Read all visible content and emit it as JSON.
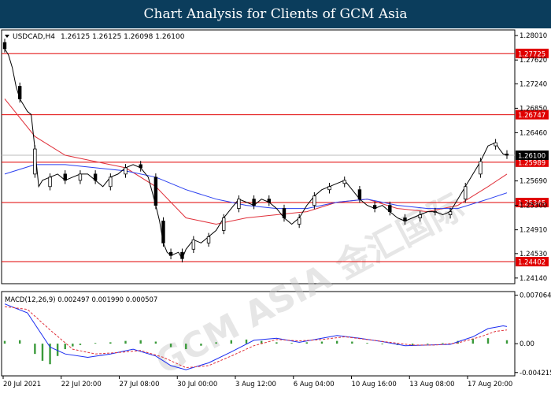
{
  "header": {
    "title": "Chart Analysis for Clients of GCM Asia"
  },
  "chart_data": {
    "type": "candlestick",
    "instrument": "USDCAD,H4",
    "ohlc_text": "1.26125 1.26125 1.26098 1.26100",
    "ylim": [
      1.2405,
      1.281
    ],
    "price_ticks": [
      "1.28010",
      "1.27620",
      "1.27240",
      "1.26850",
      "1.26460",
      "1.26100",
      "1.25690",
      "1.25300",
      "1.24910",
      "1.24530",
      "1.24140"
    ],
    "current_price": "1.26100",
    "levels": [
      {
        "label": "1.27725",
        "value": 1.27725
      },
      {
        "label": "1.26747",
        "value": 1.26747
      },
      {
        "label": "1.25989",
        "value": 1.25989
      },
      {
        "label": "1.25345",
        "value": 1.25345
      },
      {
        "label": "1.24402",
        "value": 1.24402
      }
    ],
    "x_labels": [
      "20 Jul 2021",
      "22 Jul 20:00",
      "27 Jul 08:00",
      "30 Jul 00:00",
      "3 Aug 12:00",
      "6 Aug 04:00",
      "10 Aug 16:00",
      "13 Aug 08:00",
      "17 Aug 20:00"
    ],
    "close_path": [
      [
        0,
        1.278
      ],
      [
        1,
        1.277
      ],
      [
        2,
        1.275
      ],
      [
        3,
        1.272
      ],
      [
        4,
        1.27
      ],
      [
        5,
        1.269
      ],
      [
        6,
        1.268
      ],
      [
        7,
        1.2675
      ],
      [
        8,
        1.262
      ],
      [
        9,
        1.256
      ],
      [
        10,
        1.257
      ],
      [
        12,
        1.2575
      ],
      [
        14,
        1.258
      ],
      [
        16,
        1.257
      ],
      [
        18,
        1.2575
      ],
      [
        20,
        1.258
      ],
      [
        22,
        1.258
      ],
      [
        24,
        1.257
      ],
      [
        26,
        1.256
      ],
      [
        28,
        1.2575
      ],
      [
        30,
        1.258
      ],
      [
        32,
        1.259
      ],
      [
        34,
        1.2595
      ],
      [
        36,
        1.259
      ],
      [
        38,
        1.2575
      ],
      [
        40,
        1.253
      ],
      [
        41,
        1.2505
      ],
      [
        42,
        1.247
      ],
      [
        43,
        1.2455
      ],
      [
        44,
        1.245
      ],
      [
        46,
        1.2455
      ],
      [
        47,
        1.2445
      ],
      [
        48,
        1.246
      ],
      [
        50,
        1.2475
      ],
      [
        52,
        1.247
      ],
      [
        54,
        1.248
      ],
      [
        56,
        1.249
      ],
      [
        58,
        1.251
      ],
      [
        60,
        1.2525
      ],
      [
        62,
        1.254
      ],
      [
        64,
        1.2535
      ],
      [
        66,
        1.253
      ],
      [
        68,
        1.254
      ],
      [
        70,
        1.2535
      ],
      [
        72,
        1.2525
      ],
      [
        74,
        1.251
      ],
      [
        76,
        1.25
      ],
      [
        78,
        1.251
      ],
      [
        80,
        1.253
      ],
      [
        82,
        1.2545
      ],
      [
        84,
        1.2555
      ],
      [
        86,
        1.256
      ],
      [
        88,
        1.2565
      ],
      [
        90,
        1.257
      ],
      [
        92,
        1.2555
      ],
      [
        94,
        1.254
      ],
      [
        96,
        1.253
      ],
      [
        98,
        1.2525
      ],
      [
        100,
        1.253
      ],
      [
        102,
        1.252
      ],
      [
        104,
        1.251
      ],
      [
        106,
        1.2505
      ],
      [
        108,
        1.251
      ],
      [
        110,
        1.2515
      ],
      [
        112,
        1.252
      ],
      [
        114,
        1.252
      ],
      [
        116,
        1.2515
      ],
      [
        118,
        1.252
      ],
      [
        120,
        1.254
      ],
      [
        122,
        1.256
      ],
      [
        124,
        1.258
      ],
      [
        126,
        1.26
      ],
      [
        128,
        1.2625
      ],
      [
        130,
        1.263
      ],
      [
        131,
        1.262
      ],
      [
        132,
        1.2612
      ],
      [
        133,
        1.261
      ]
    ],
    "candle_marks": [
      [
        0,
        1.279,
        1.278
      ],
      [
        4,
        1.272,
        1.27
      ],
      [
        8,
        1.258,
        1.262
      ],
      [
        12,
        1.256,
        1.2575
      ],
      [
        16,
        1.258,
        1.257
      ],
      [
        20,
        1.257,
        1.258
      ],
      [
        24,
        1.258,
        1.257
      ],
      [
        28,
        1.256,
        1.2575
      ],
      [
        32,
        1.258,
        1.259
      ],
      [
        36,
        1.2595,
        1.259
      ],
      [
        40,
        1.2575,
        1.253
      ],
      [
        42,
        1.2505,
        1.247
      ],
      [
        44,
        1.2455,
        1.245
      ],
      [
        47,
        1.2455,
        1.2445
      ],
      [
        50,
        1.246,
        1.2475
      ],
      [
        54,
        1.247,
        1.248
      ],
      [
        58,
        1.249,
        1.251
      ],
      [
        62,
        1.2525,
        1.254
      ],
      [
        66,
        1.254,
        1.253
      ],
      [
        70,
        1.254,
        1.2535
      ],
      [
        74,
        1.2525,
        1.251
      ],
      [
        78,
        1.25,
        1.251
      ],
      [
        82,
        1.253,
        1.2545
      ],
      [
        86,
        1.2555,
        1.256
      ],
      [
        90,
        1.2565,
        1.257
      ],
      [
        94,
        1.2555,
        1.254
      ],
      [
        98,
        1.253,
        1.2525
      ],
      [
        102,
        1.253,
        1.252
      ],
      [
        106,
        1.251,
        1.2505
      ],
      [
        110,
        1.251,
        1.2515
      ],
      [
        114,
        1.252,
        1.252
      ],
      [
        118,
        1.2515,
        1.252
      ],
      [
        122,
        1.254,
        1.256
      ],
      [
        126,
        1.258,
        1.26
      ],
      [
        130,
        1.2625,
        1.263
      ],
      [
        133,
        1.2612,
        1.261
      ]
    ],
    "red_ma": [
      [
        0,
        1.27
      ],
      [
        8,
        1.264
      ],
      [
        16,
        1.261
      ],
      [
        24,
        1.26
      ],
      [
        32,
        1.259
      ],
      [
        40,
        1.256
      ],
      [
        48,
        1.251
      ],
      [
        56,
        1.25
      ],
      [
        64,
        1.251
      ],
      [
        72,
        1.2515
      ],
      [
        80,
        1.252
      ],
      [
        88,
        1.2535
      ],
      [
        96,
        1.254
      ],
      [
        104,
        1.2525
      ],
      [
        112,
        1.252
      ],
      [
        120,
        1.253
      ],
      [
        128,
        1.256
      ],
      [
        133,
        1.258
      ]
    ],
    "blue_ma": [
      [
        0,
        1.258
      ],
      [
        8,
        1.2595
      ],
      [
        16,
        1.2595
      ],
      [
        24,
        1.259
      ],
      [
        32,
        1.2585
      ],
      [
        40,
        1.2575
      ],
      [
        48,
        1.2555
      ],
      [
        56,
        1.254
      ],
      [
        64,
        1.253
      ],
      [
        72,
        1.2525
      ],
      [
        80,
        1.2525
      ],
      [
        88,
        1.2535
      ],
      [
        96,
        1.254
      ],
      [
        104,
        1.253
      ],
      [
        112,
        1.2525
      ],
      [
        120,
        1.2525
      ],
      [
        128,
        1.254
      ],
      [
        133,
        1.255
      ]
    ],
    "macd": {
      "label": "MACD(12,26,9) 0.002497 0.001990 0.000507",
      "ylim": [
        -0.0047,
        0.0076
      ],
      "ticks": [
        "0.007064",
        "0.00",
        "-0.004215"
      ],
      "tick_values": [
        0.007064,
        0.0,
        -0.004215
      ],
      "histogram": [
        [
          0,
          0.0004
        ],
        [
          4,
          0.0005
        ],
        [
          8,
          -0.0015
        ],
        [
          10,
          -0.0025
        ],
        [
          12,
          -0.003
        ],
        [
          14,
          -0.0018
        ],
        [
          16,
          -0.0008
        ],
        [
          18,
          -0.0004
        ],
        [
          20,
          -0.0002
        ],
        [
          24,
          0.0001
        ],
        [
          28,
          0.0002
        ],
        [
          32,
          0.0004
        ],
        [
          36,
          0.0005
        ],
        [
          40,
          0.0003
        ],
        [
          44,
          -0.0005
        ],
        [
          48,
          -0.0008
        ],
        [
          52,
          -0.0003
        ],
        [
          56,
          0.0002
        ],
        [
          60,
          0.0005
        ],
        [
          64,
          0.0006
        ],
        [
          68,
          0.0004
        ],
        [
          72,
          0.0002
        ],
        [
          76,
          0.0001
        ],
        [
          80,
          0.0002
        ],
        [
          84,
          0.0003
        ],
        [
          88,
          0.0004
        ],
        [
          92,
          0.0003
        ],
        [
          96,
          0.0001
        ],
        [
          100,
          -0.0001
        ],
        [
          104,
          -0.0002
        ],
        [
          108,
          -0.0002
        ],
        [
          112,
          -0.0001
        ],
        [
          116,
          0.0001
        ],
        [
          120,
          0.0004
        ],
        [
          124,
          0.0007
        ],
        [
          128,
          0.0008
        ],
        [
          133,
          0.0005
        ]
      ],
      "macd_line": [
        [
          0,
          0.0058
        ],
        [
          6,
          0.0045
        ],
        [
          12,
          -0.0005
        ],
        [
          16,
          -0.0015
        ],
        [
          22,
          -0.002
        ],
        [
          28,
          -0.0015
        ],
        [
          34,
          -0.0008
        ],
        [
          40,
          -0.0018
        ],
        [
          44,
          -0.0032
        ],
        [
          48,
          -0.0038
        ],
        [
          54,
          -0.0028
        ],
        [
          60,
          -0.0012
        ],
        [
          66,
          0.0005
        ],
        [
          72,
          0.0008
        ],
        [
          78,
          0.0002
        ],
        [
          84,
          0.0008
        ],
        [
          88,
          0.0012
        ],
        [
          94,
          0.0008
        ],
        [
          100,
          0.0003
        ],
        [
          106,
          -0.0003
        ],
        [
          112,
          -0.0002
        ],
        [
          118,
          -0.0001
        ],
        [
          124,
          0.001
        ],
        [
          128,
          0.0022
        ],
        [
          132,
          0.0026
        ],
        [
          133,
          0.0025
        ]
      ],
      "signal_line": [
        [
          0,
          0.0054
        ],
        [
          6,
          0.005
        ],
        [
          12,
          0.002
        ],
        [
          18,
          -0.0008
        ],
        [
          24,
          -0.0015
        ],
        [
          30,
          -0.0013
        ],
        [
          36,
          -0.001
        ],
        [
          42,
          -0.002
        ],
        [
          48,
          -0.0035
        ],
        [
          54,
          -0.0032
        ],
        [
          60,
          -0.0018
        ],
        [
          66,
          -0.0003
        ],
        [
          72,
          0.0006
        ],
        [
          78,
          0.0004
        ],
        [
          84,
          0.0006
        ],
        [
          90,
          0.001
        ],
        [
          96,
          0.0006
        ],
        [
          102,
          0.0002
        ],
        [
          108,
          -0.0002
        ],
        [
          114,
          -0.0002
        ],
        [
          120,
          0.0001
        ],
        [
          126,
          0.001
        ],
        [
          130,
          0.0018
        ],
        [
          133,
          0.002
        ]
      ]
    },
    "watermark": "GCM ASIA 金汇国际"
  }
}
